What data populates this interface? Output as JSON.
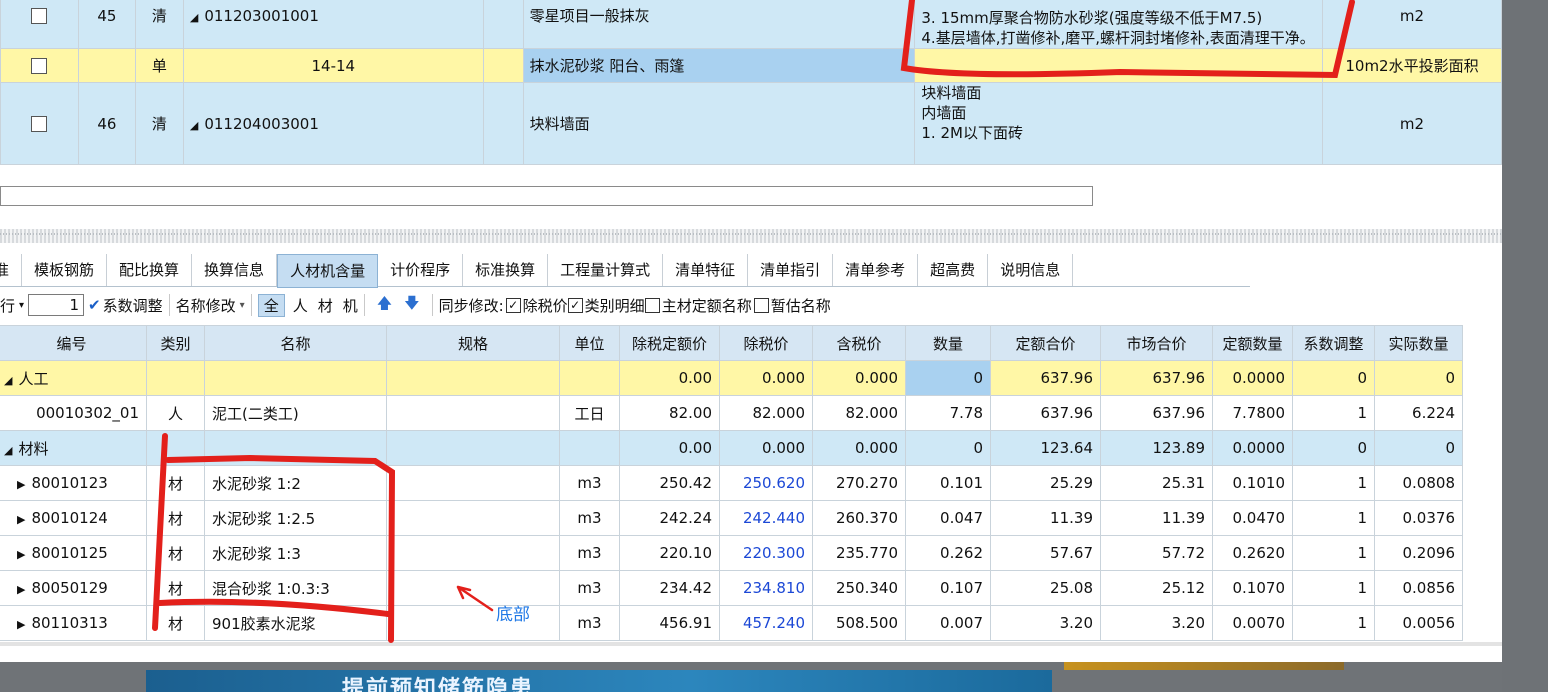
{
  "top_rows": [
    {
      "seq": "45",
      "type": "清",
      "code": "011203001001",
      "name": "零星项目一般抹灰",
      "features": [
        "3. 15mm厚聚合物防水砂浆(强度等级不低于M7.5)",
        "4.基层墙体,打凿修补,磨平,螺杆洞封堵修补,表面清理干净。"
      ],
      "unit": "m2"
    },
    {
      "seq": "",
      "type": "单",
      "code": "14-14",
      "name": "抹水泥砂浆 阳台、雨篷",
      "features": [
        ""
      ],
      "unit": "10m2水平投影面积"
    },
    {
      "seq": "46",
      "type": "清",
      "code": "011204003001",
      "name": "块料墙面",
      "features": [
        "块料墙面",
        "内墙面",
        "1. 2M以下面砖"
      ],
      "unit": "m2"
    }
  ],
  "tabs": [
    "准",
    "模板钢筋",
    "配比换算",
    "换算信息",
    "人材机含量",
    "计价程序",
    "标准换算",
    "工程量计算式",
    "清单特征",
    "清单指引",
    "清单参考",
    "超高费",
    "说明信息"
  ],
  "active_tab": "人材机含量",
  "toolbar": {
    "row_label": "行",
    "row_value": "1",
    "coef_adjust": "系数调整",
    "rename": "名称修改",
    "filter_all": "全",
    "filter_labor": "人",
    "filter_material": "材",
    "filter_machine": "机",
    "sync_label": "同步修改:",
    "opt_tax": "除税价",
    "opt_category": "类别明细",
    "opt_main": "主材定额名称",
    "opt_temp": "暂估名称"
  },
  "columns": [
    "编号",
    "类别",
    "名称",
    "规格",
    "单位",
    "除税定额价",
    "除税价",
    "含税价",
    "数量",
    "定额合价",
    "市场合价",
    "定额数量",
    "系数调整",
    "实际数量"
  ],
  "groups": [
    {
      "label": "人工",
      "style": "y",
      "values": [
        "0.00",
        "0.000",
        "0.000",
        "0",
        "637.96",
        "637.96",
        "0.0000",
        "0",
        "0"
      ],
      "items": [
        {
          "code": "00010302_01",
          "cat": "人",
          "name": "泥工(二类工)",
          "spec": "",
          "unit": "工日",
          "base": "82.00",
          "notax": "82.000",
          "tax": "82.000",
          "qty": "7.78",
          "base_total": "637.96",
          "market_total": "637.96",
          "base_qty": "7.7800",
          "coef": "1",
          "actual": "6.224"
        }
      ]
    },
    {
      "label": "材料",
      "style": "b",
      "values": [
        "0.00",
        "0.000",
        "0.000",
        "0",
        "123.64",
        "123.89",
        "0.0000",
        "0",
        "0"
      ],
      "items": [
        {
          "code": "80010123",
          "cat": "材",
          "name": "水泥砂浆 1:2",
          "spec": "",
          "unit": "m3",
          "base": "250.42",
          "notax": "250.620",
          "tax": "270.270",
          "qty": "0.101",
          "base_total": "25.29",
          "market_total": "25.31",
          "base_qty": "0.1010",
          "coef": "1",
          "actual": "0.0808"
        },
        {
          "code": "80010124",
          "cat": "材",
          "name": "水泥砂浆 1:2.5",
          "spec": "",
          "unit": "m3",
          "base": "242.24",
          "notax": "242.440",
          "tax": "260.370",
          "qty": "0.047",
          "base_total": "11.39",
          "market_total": "11.39",
          "base_qty": "0.0470",
          "coef": "1",
          "actual": "0.0376"
        },
        {
          "code": "80010125",
          "cat": "材",
          "name": "水泥砂浆 1:3",
          "spec": "",
          "unit": "m3",
          "base": "220.10",
          "notax": "220.300",
          "tax": "235.770",
          "qty": "0.262",
          "base_total": "57.67",
          "market_total": "57.72",
          "base_qty": "0.2620",
          "coef": "1",
          "actual": "0.2096"
        },
        {
          "code": "80050129",
          "cat": "材",
          "name": "混合砂浆 1:0.3:3",
          "spec": "",
          "unit": "m3",
          "base": "234.42",
          "notax": "234.810",
          "tax": "250.340",
          "qty": "0.107",
          "base_total": "25.08",
          "market_total": "25.12",
          "base_qty": "0.1070",
          "coef": "1",
          "actual": "0.0856"
        },
        {
          "code": "80110313",
          "cat": "材",
          "name": "901胶素水泥浆",
          "spec": "",
          "unit": "m3",
          "base": "456.91",
          "notax": "457.240",
          "tax": "508.500",
          "qty": "0.007",
          "base_total": "3.20",
          "market_total": "3.20",
          "base_qty": "0.0070",
          "coef": "1",
          "actual": "0.0056"
        }
      ]
    }
  ],
  "annotation": {
    "label": "底部",
    "color": "#e3201b"
  },
  "banner_text": "提前预知储筋隐患"
}
